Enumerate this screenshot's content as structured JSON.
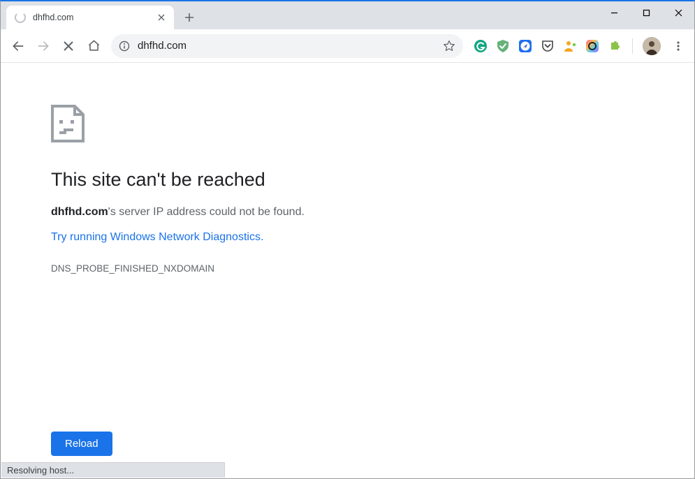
{
  "tab": {
    "title": "dhfhd.com"
  },
  "omnibox": {
    "url": "dhfhd.com"
  },
  "extensions": [
    {
      "name": "grammarly-extension-icon"
    },
    {
      "name": "adguard-extension-icon"
    },
    {
      "name": "safari-extension-icon"
    },
    {
      "name": "pocket-extension-icon"
    },
    {
      "name": "user-extension-icon"
    },
    {
      "name": "colorpicker-extension-icon"
    },
    {
      "name": "puzzle-extension-icon"
    }
  ],
  "error": {
    "title": "This site can't be reached",
    "domain": "dhfhd.com",
    "message_suffix": "'s server IP address could not be found.",
    "diagnostics_link": "Try running Windows Network Diagnostics",
    "diagnostics_period": ".",
    "code": "DNS_PROBE_FINISHED_NXDOMAIN",
    "reload_label": "Reload"
  },
  "status": "Resolving host..."
}
